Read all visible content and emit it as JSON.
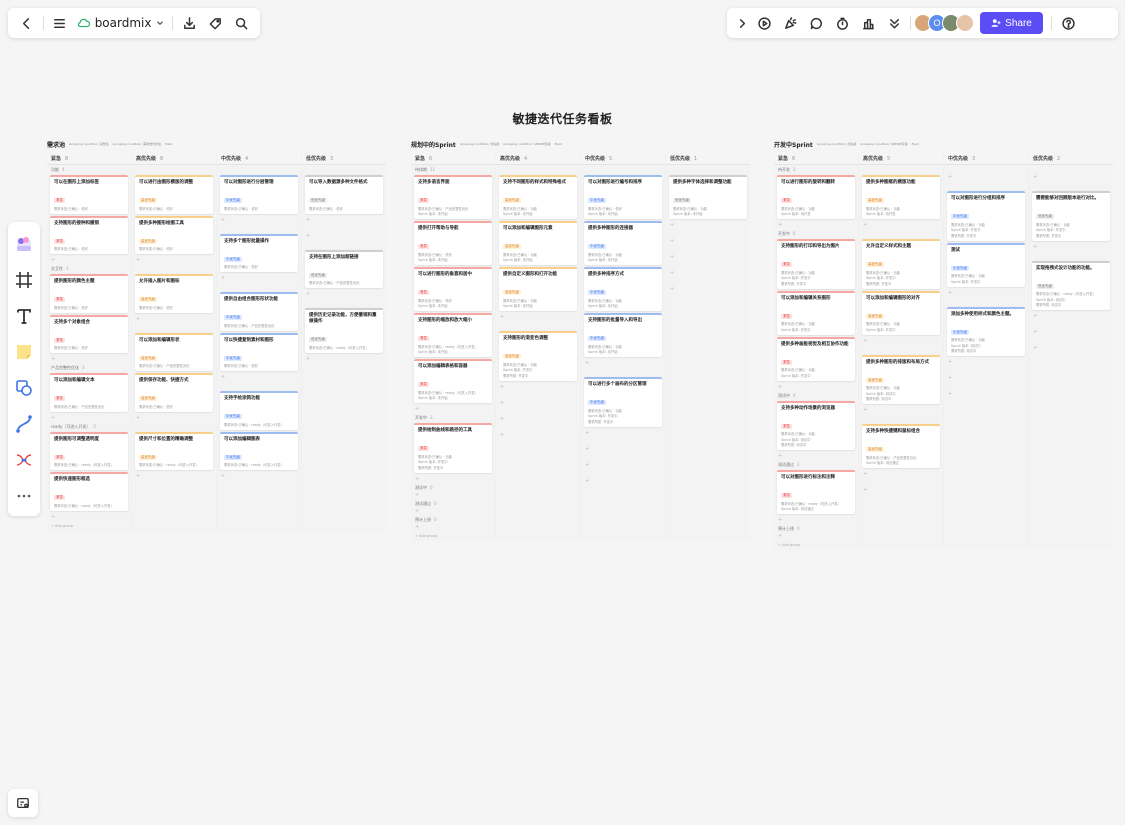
{
  "toolbar_left": {
    "brand": "boardmix",
    "icons": [
      "back-icon",
      "menu-icon",
      "cloud-icon",
      "chevron-down-icon",
      "download-icon",
      "tag-icon",
      "search-icon"
    ]
  },
  "toolbar_right": {
    "icons": [
      "collapse-icon",
      "play-icon",
      "celebrate-icon",
      "comment-icon",
      "timer-icon",
      "vote-icon",
      "more-icon",
      "help-icon"
    ],
    "avatars": [
      {
        "label": "",
        "color": "#d9a67a"
      },
      {
        "label": "O",
        "color": "#5b8def"
      },
      {
        "label": "",
        "color": "#7a8a6a"
      },
      {
        "label": "",
        "color": "#e6c4a8"
      }
    ],
    "share_label": "Share"
  },
  "left_tools": [
    "template-icon",
    "frame-icon",
    "text-icon",
    "sticky-note-icon",
    "shape-icon",
    "connector-icon",
    "mindmap-icon",
    "more-tools-icon"
  ],
  "board_title": "敏捷迭代任务看板",
  "colors": {
    "accent": "#5b4df5",
    "red": "#e5484d",
    "orange": "#d9822b",
    "blue": "#3e74e6"
  },
  "boards": [
    {
      "name": "需求池",
      "meta": [
        "Grouping condition: 完整性",
        "Grouping condition: 需求迭代状态",
        "Field"
      ],
      "columns": [
        {
          "title": "紧急",
          "count": "8"
        },
        {
          "title": "高优先级",
          "count": "8"
        },
        {
          "title": "中优先级",
          "count": "4"
        },
        {
          "title": "低优先级",
          "count": "3"
        }
      ],
      "groups": [
        {
          "label": "功能",
          "count": "4",
          "cols": [
            [
              {
                "t": "可以在图形上添加标签",
                "tag": "紧急",
                "c": "red",
                "m": [
                  "需求状态:已确认 · 低好"
                ]
              },
              {
                "t": "支持图形的接种和撤销",
                "tag": "紧急",
                "c": "red",
                "m": [
                  "需求状态:已确认 · 低好"
                ]
              }
            ],
            [
              {
                "t": "可以进行由图形模版的调整",
                "tag": "高优先级",
                "c": "orange",
                "m": [
                  "需求状态:已确认 · 低好"
                ]
              },
              {
                "t": "提供多种图形绘图工具",
                "tag": "高优先级",
                "c": "orange",
                "m": [
                  "需求状态:已确认 · 低好"
                ]
              }
            ],
            [
              {
                "t": "可以对图形进行分层管理",
                "tag": "中优先级",
                "c": "blue",
                "m": [
                  "需求状态:已确认 · 低好"
                ]
              }
            ],
            [
              {
                "t": "可以导入数据源多种文件格式",
                "tag": "低优先级",
                "c": "gray",
                "m": [
                  "需求状态:已确认 · 低好"
                ]
              }
            ]
          ]
        },
        {
          "label": "交互性",
          "count": "3",
          "cols": [
            [
              {
                "t": "提供图形的颜色主题",
                "tag": "紧急",
                "c": "red",
                "m": [
                  "需求状态:已确认 · 低好"
                ]
              },
              {
                "t": "支持多个对象组合",
                "tag": "紧急",
                "c": "red",
                "m": [
                  "需求状态:已确认 · 低好"
                ]
              }
            ],
            [
              {
                "t": "允许插入图片和图标",
                "tag": "高优先级",
                "c": "orange",
                "m": [
                  "需求状态:已确认 · 低好"
                ]
              }
            ],
            [
              {
                "t": "支持多个图形批量操作",
                "tag": "中优先级",
                "c": "blue",
                "m": [
                  "需求状态:已确认 · 低好"
                ]
              }
            ],
            []
          ]
        },
        {
          "label": "产品完整性优化",
          "count": "3",
          "cols": [
            [
              {
                "t": "可以添加和编辑文本",
                "tag": "紧急",
                "c": "red",
                "m": [
                  "需求状态:已确认 · 产品完整性优化"
                ]
              }
            ],
            [
              {
                "t": "可以添加和编辑形状",
                "tag": "高优先级",
                "c": "orange",
                "m": [
                  "需求状态:已确认 · 产品完整性优化"
                ]
              },
              {
                "t": "提供保存功能、快捷方式",
                "tag": "高优先级",
                "c": "orange",
                "m": [
                  "需求状态:已确认 · 低好"
                ]
              }
            ],
            [
              {
                "t": "提供自由组合图形形状功能",
                "tag": "中优先级",
                "c": "blue",
                "m": [
                  "需求状态:已确认 · 产品完整性优化"
                ]
              },
              {
                "t": "可以快捷复制素材和图形",
                "tag": "中优先级",
                "c": "blue",
                "m": [
                  "需求状态:已确认 · 低好"
                ]
              }
            ],
            [
              {
                "t": "支持在图形上添加超链接",
                "tag": "低优先级",
                "c": "gray",
                "m": [
                  "需求状态:已确认 · 产品完整性优化"
                ]
              }
            ]
          ]
        },
        {
          "label": "ready（可进入开发）",
          "count": "5",
          "cols": [
            [
              {
                "t": "提供图形可调整透明度",
                "tag": "紧急",
                "c": "red",
                "m": [
                  "需求状态:已确认 · ready（可进入开发）"
                ]
              },
              {
                "t": "提供快速图形框选",
                "tag": "紧急",
                "c": "red",
                "m": [
                  "需求状态:已确认 · ready（可进入开发）"
                ]
              }
            ],
            [
              {
                "t": "提供尺寸和位置的精确调整",
                "tag": "高优先级",
                "c": "orange",
                "m": [
                  "需求状态:已确认 · ready（可进入开发）"
                ]
              }
            ],
            [
              {
                "t": "支持手绘涂鸦功能",
                "tag": "中优先级",
                "c": "blue",
                "m": [
                  "需求状态:已确认 · ready（可进入开发）"
                ]
              },
              {
                "t": "可以添加编辑图表",
                "tag": "中优先级",
                "c": "blue",
                "m": [
                  "需求状态:已确认 · ready（可进入开发）"
                ]
              }
            ],
            [
              {
                "t": "提供历史记录功能，方便撤销和重做操作",
                "tag": "低优先级",
                "c": "gray",
                "m": [
                  "需求状态:已确认 · ready（可进入开发）"
                ]
              }
            ]
          ]
        }
      ],
      "add_group": "+ Add group"
    },
    {
      "name": "规划中的Sprint",
      "meta": [
        "Grouping condition: 优先级",
        "Grouping condition: SPRINT阶段",
        "Field"
      ],
      "columns": [
        {
          "title": "紧急",
          "count": "6"
        },
        {
          "title": "高优先级",
          "count": "4"
        },
        {
          "title": "中优先级",
          "count": "5"
        },
        {
          "title": "低优先级",
          "count": "1"
        }
      ],
      "groups": [
        {
          "label": "待排期",
          "count": "11",
          "cols": [
            [
              {
                "t": "支持多语言界面",
                "tag": "紧急",
                "c": "red",
                "m": [
                  "需求状态:已确认 · 产品完整性优化",
                  "Sprint 版本: 未开始"
                ]
              },
              {
                "t": "提供打开帮助与导航",
                "tag": "紧急",
                "c": "red",
                "m": [
                  "需求状态:已确认 · 低好",
                  "Sprint 版本: 未开始"
                ]
              },
              {
                "t": "可以进行图形的垂直和居中",
                "tag": "紧急",
                "c": "red",
                "m": [
                  "需求状态:已确认 · 低好",
                  "Sprint 版本: 未开始"
                ]
              },
              {
                "t": "支持图形的缩放和放大缩小",
                "tag": "紧急",
                "c": "red",
                "m": [
                  "需求状态:已确认 · ready（可进入开发）",
                  "Sprint 版本: 未开始"
                ]
              },
              {
                "t": "可以添加编辑表格和容器",
                "tag": "紧急",
                "c": "red",
                "m": [
                  "需求状态:已确认 · ready（可进入开发）",
                  "Sprint 版本: 未开始"
                ]
              }
            ],
            [
              {
                "t": "支持不同图形的样式和特殊格式",
                "tag": "高优先级",
                "c": "orange",
                "m": [
                  "需求状态:已确认 · 功能",
                  "Sprint 版本: 未开始"
                ]
              },
              {
                "t": "可以添加和编辑图形元素",
                "tag": "高优先级",
                "c": "orange",
                "m": [
                  "需求状态:已确认 · 功能",
                  "Sprint 版本: 未开始"
                ]
              },
              {
                "t": "提供自定义图形和打开功能",
                "tag": "高优先级",
                "c": "orange",
                "m": [
                  "需求状态:已确认 · 功能",
                  "Sprint 版本: 未开始"
                ]
              }
            ],
            [
              {
                "t": "可以对图形进行编号和排序",
                "tag": "中优先级",
                "c": "blue",
                "m": [
                  "需求状态:已确认 · 低好",
                  "Sprint 版本: 未开始"
                ]
              },
              {
                "t": "提供多种图形的连接器",
                "tag": "中优先级",
                "c": "blue",
                "m": [
                  "需求状态:已确认 · 功能",
                  "Sprint 版本: 未开始"
                ]
              },
              {
                "t": "提供多种排序方式",
                "tag": "中优先级",
                "c": "blue",
                "m": [
                  "需求状态:已确认 · 功能",
                  "Sprint 版本: 未开始"
                ]
              },
              {
                "t": "支持图形的批量导入和导出",
                "tag": "中优先级",
                "c": "blue",
                "m": [
                  "需求状态:已确认 · 功能",
                  "Sprint 版本: 未开始"
                ]
              }
            ],
            [
              {
                "t": "提供多种字体选择和调整功能",
                "tag": "低优先级",
                "c": "gray",
                "m": [
                  "需求状态:已确认 · 功能",
                  "Sprint 版本: 未开始"
                ]
              }
            ]
          ]
        },
        {
          "label": "开发中",
          "count": "3",
          "cols": [
            [
              {
                "t": "提供绘制曲线和路径的工具",
                "tag": "紧急",
                "c": "red",
                "m": [
                  "需求状态:已确认 · 功能",
                  "Sprint 版本: 开发中",
                  "需求所属: 开发中"
                ]
              }
            ],
            [
              {
                "t": "支持图形的渐变色调整",
                "tag": "高优先级",
                "c": "orange",
                "m": [
                  "需求状态:已确认 · 功能",
                  "Sprint 版本: 开发中",
                  "需求所属: 开发中"
                ]
              }
            ],
            [
              {
                "t": "可以进行多个画布的分区管理",
                "tag": "中优先级",
                "c": "blue",
                "m": [
                  "需求状态:已确认 · 功能",
                  "Sprint 版本: 开发中",
                  "需求所属: 开发中"
                ]
              }
            ],
            []
          ]
        },
        {
          "label": "测试中",
          "count": "0",
          "cols": [
            [],
            [],
            [],
            []
          ]
        },
        {
          "label": "测试通过",
          "count": "0",
          "cols": [
            [],
            [],
            [],
            []
          ]
        },
        {
          "label": "预计上线",
          "count": "0",
          "cols": [
            [],
            [],
            [],
            []
          ]
        }
      ],
      "add_group": "+ Add group"
    },
    {
      "name": "开发中Sprint",
      "meta": [
        "Grouping condition: 优先级",
        "Grouping condition: SPRINT阶段",
        "Field"
      ],
      "columns": [
        {
          "title": "紧急",
          "count": "6"
        },
        {
          "title": "高优先级",
          "count": "5"
        },
        {
          "title": "中优先级",
          "count": "3"
        },
        {
          "title": "低优先级",
          "count": "2"
        }
      ],
      "groups": [
        {
          "label": "待开发",
          "count": "2",
          "cols": [
            [
              {
                "t": "可以进行图形的旋转和翻转",
                "tag": "紧急",
                "c": "red",
                "m": [
                  "需求状态:已确认 · 功能",
                  "Sprint 版本: 待开发"
                ]
              }
            ],
            [
              {
                "t": "提供多种图框的模版功能",
                "tag": "高优先级",
                "c": "orange",
                "m": [
                  "需求状态:已确认 · 功能",
                  "Sprint 版本: 待开发"
                ]
              }
            ],
            [],
            []
          ]
        },
        {
          "label": "开发中",
          "count": "6",
          "cols": [
            [
              {
                "t": "支持图形的打印和导出为图片",
                "tag": "紧急",
                "c": "red",
                "m": [
                  "需求状态:已确认 · 功能",
                  "Sprint 版本: 开发中",
                  "需求所属: 开发中"
                ]
              },
              {
                "t": "可以添加和编辑关系图形",
                "tag": "紧急",
                "c": "red",
                "m": [
                  "需求状态:已确认 · 功能",
                  "Sprint 版本: 开发中"
                ]
              },
              {
                "t": "提供多种画板视觉及相互协作功能",
                "tag": "紧急",
                "c": "red",
                "m": [
                  "需求状态:已确认 · 功能",
                  "Sprint 版本: 开发中"
                ]
              }
            ],
            [
              {
                "t": "允许自定义样式和主题",
                "tag": "高优先级",
                "c": "orange",
                "m": [
                  "需求状态:已确认 · 功能",
                  "Sprint 版本: 开发中",
                  "需求所属: 开发中"
                ]
              },
              {
                "t": "可以添加和编辑图形的对齐",
                "tag": "高优先级",
                "c": "orange",
                "m": [
                  "需求状态:已确认 · 功能",
                  "Sprint 版本: 开发中"
                ]
              }
            ],
            [
              {
                "t": "可以对图形进行分组和排序",
                "tag": "中优先级",
                "c": "blue",
                "m": [
                  "需求状态:已确认 · 功能",
                  "Sprint 版本: 开发中",
                  "需求所属: 开发中"
                ]
              },
              {
                "t": "测试",
                "tag": "中优先级",
                "c": "blue",
                "m": [
                  "需求状态:已确认 · 功能",
                  "Sprint 版本: 开发中"
                ]
              }
            ],
            [
              {
                "t": "需要能够对回顾版本进行对比。",
                "tag": "低优先级",
                "c": "gray",
                "m": [
                  "需求状态:已确认 · 功能",
                  "Sprint 版本: 开发中",
                  "需求所属: 开发中"
                ]
              }
            ]
          ]
        },
        {
          "label": "测试中",
          "count": "4",
          "cols": [
            [
              {
                "t": "支持多种动作场景的浏览器",
                "tag": "紧急",
                "c": "red",
                "m": [
                  "需求状态:已确认 · 功能",
                  "Sprint 版本: 测试中",
                  "需求所属: 测试中"
                ]
              }
            ],
            [
              {
                "t": "提供多种图形的排版和布局方式",
                "tag": "高优先级",
                "c": "orange",
                "m": [
                  "需求状态:已确认 · 功能",
                  "Sprint 版本: 测试中",
                  "需求所属: 测试中"
                ]
              }
            ],
            [
              {
                "t": "添加多种使用样式和颜色主题。",
                "tag": "中优先级",
                "c": "blue",
                "m": [
                  "需求状态:已确认 · 功能",
                  "Sprint 版本: 测试中",
                  "需求所属: 测试中"
                ]
              }
            ],
            [
              {
                "t": "实现拖拽式设计功能的功能。",
                "tag": "低优先级",
                "c": "gray",
                "m": [
                  "需求状态:已确认 · ready（可进入开发）",
                  "Sprint 版本: 测试中",
                  "需求所属: 测试中"
                ]
              }
            ]
          ]
        },
        {
          "label": "测试通过",
          "count": "2",
          "cols": [
            [
              {
                "t": "可以对图形进行标注和注释",
                "tag": "紧急",
                "c": "red",
                "m": [
                  "需求状态:已确认 · ready（可进入开发）",
                  "Sprint 版本: 测试通过"
                ]
              }
            ],
            [
              {
                "t": "支持多种快捷键和鼠标组合",
                "tag": "高优先级",
                "c": "orange",
                "m": [
                  "需求状态:已确认 · 产品完整性优化",
                  "Sprint 版本: 测试通过"
                ]
              }
            ],
            [],
            []
          ]
        },
        {
          "label": "预计上线",
          "count": "0",
          "cols": [
            [],
            [],
            [],
            []
          ]
        }
      ],
      "add_group": "+ Add group"
    }
  ]
}
